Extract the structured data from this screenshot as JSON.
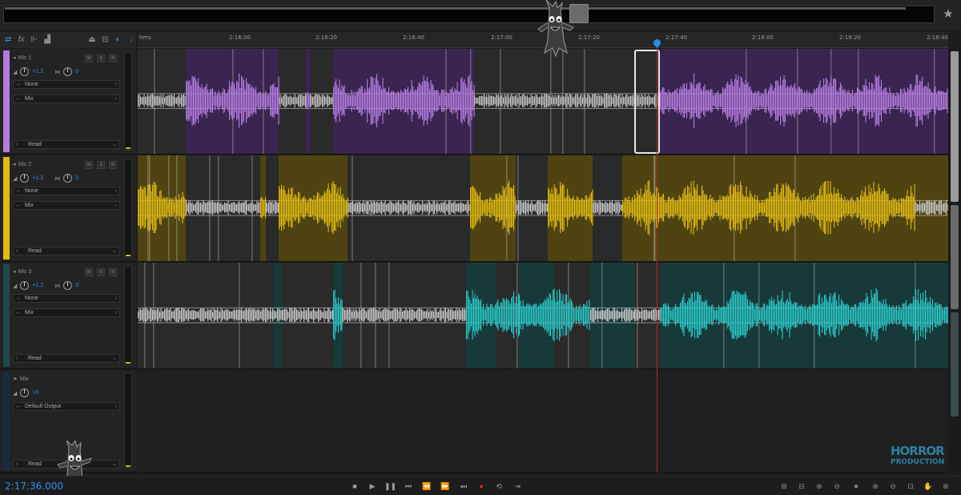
{
  "colors": {
    "mic1": "#b27ddf",
    "mic1_bg": "#3a2451",
    "mic1_hi": "#4a2d68",
    "mic2": "#e0ba10",
    "mic2_bg": "#4f4411",
    "mic2_hi": "#5e5112",
    "mic3": "#29c8c8",
    "mic3_bg": "#18393a",
    "mic3_hi": "#1d4a4b",
    "lane_dark": "#2a2a2a",
    "accent": "#2d8ceb",
    "record": "#e52424"
  },
  "ruler": {
    "labels": [
      "hms",
      "2:16:00",
      "2:16:20",
      "2:16:40",
      "2:17:00",
      "2:17:20",
      "2:17:40",
      "2:18:00",
      "2:18:20",
      "2:18:40"
    ]
  },
  "tracks": [
    {
      "name": "Mic 1",
      "volume": "+1.2",
      "pan": "0",
      "input": "None",
      "output": "Mix",
      "automation": "Read"
    },
    {
      "name": "Mic 2",
      "volume": "+1.2",
      "pan": "0",
      "input": "None",
      "output": "Mix",
      "automation": "Read"
    },
    {
      "name": "Mic 3",
      "volume": "+1.2",
      "pan": "0",
      "input": "None",
      "output": "Mix",
      "automation": "Read"
    }
  ],
  "master": {
    "name": "Mix",
    "volume": "+0",
    "output": "Default Output",
    "automation": "Read"
  },
  "transport": {
    "time": "2:17:36.000",
    "buttons": [
      "stop-icon",
      "play-icon",
      "pause-icon",
      "go-start-icon",
      "rewind-icon",
      "fast-forward-icon",
      "go-end-icon",
      "record-icon",
      "loop-icon",
      "skip-icon"
    ]
  },
  "zoom_tools": [
    "zoom-in-amplitude-icon",
    "zoom-out-amplitude-icon",
    "zoom-in-time-icon",
    "zoom-out-time-icon",
    "zoom-full-icon",
    "zoom-in-point-icon",
    "zoom-out-point-icon",
    "zoom-selection-icon",
    "hand-icon",
    "zoom-reset-icon"
  ],
  "logo": {
    "top": "HORROR",
    "bottom": "PRODUCTION"
  }
}
